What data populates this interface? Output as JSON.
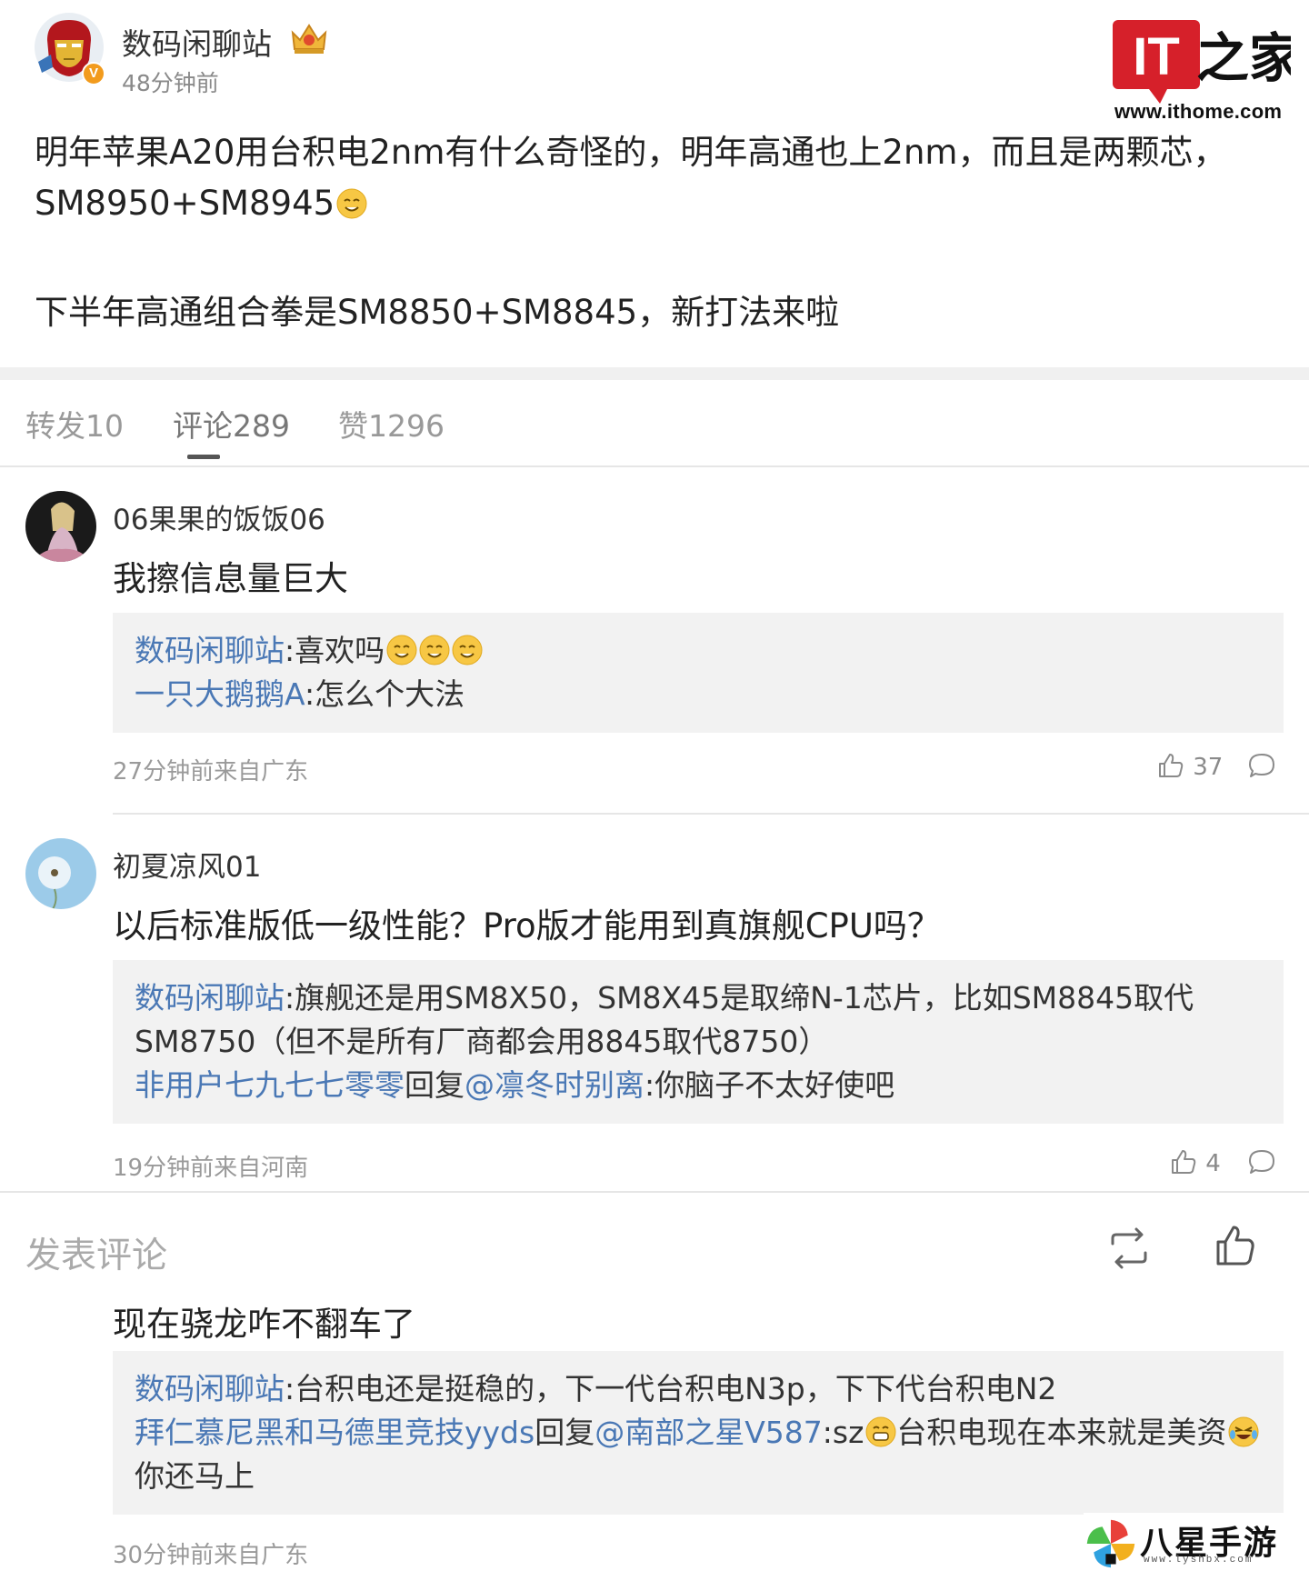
{
  "colors": {
    "link_blue": "#4a78b5",
    "brand_red": "#d6202a",
    "badge_orange": "#f29b1d"
  },
  "post": {
    "author": "数码闲聊站",
    "time": "48分钟前",
    "verified_badge": "V",
    "author_badge_icon": "crown-icon",
    "line1": "明年苹果A20用台积电2nm有什么奇怪的，明年高通也上2nm，而且是两颗芯，",
    "line2": "SM8950+SM8945",
    "line3": "下半年高通组合拳是SM8850+SM8845，新打法来啦"
  },
  "logo": {
    "mark": "IT之家",
    "url": "www.ithome.com"
  },
  "tabs": [
    {
      "label": "转发10"
    },
    {
      "label": "评论289"
    },
    {
      "label": "赞1296"
    }
  ],
  "comments": [
    {
      "user": "06果果的饭饭06",
      "text": "我擦信息量巨大",
      "replies": [
        {
          "name": "数码闲聊站",
          "text": ":喜欢吗"
        },
        {
          "name": "一只大鹅鹅A",
          "text": ":怎么个大法"
        }
      ],
      "meta": "27分钟前来自广东",
      "likes": "37"
    },
    {
      "user": "初夏凉风01",
      "text": "以后标准版低一级性能？Pro版才能用到真旗舰CPU吗？",
      "replies": [
        {
          "name": "数码闲聊站",
          "text": ":旗舰还是用SM8X50，SM8X45是取缔N-1芯片，比如SM8845取代",
          "cont": "SM8750（但不是所有厂商都会用8845取代8750）"
        },
        {
          "name": "非用户七九七七零零",
          "mid": "回复",
          "at": "@凛冬时别离",
          "text": ":你脑子不太好使吧"
        }
      ],
      "meta": "19分钟前来自河南",
      "likes": "4"
    },
    {
      "text": "现在骁龙咋不翻车了",
      "replies": [
        {
          "name": "数码闲聊站",
          "text": ":台积电还是挺稳的，下一代台积电N3p，下下代台积电N2"
        },
        {
          "name": "拜仁慕尼黑和马德里竞技yyds",
          "mid": "回复",
          "at": "@南部之星V587",
          "text": ":sz",
          "text2": "台积电现在本来就是美资",
          "cont": "你还马上"
        }
      ],
      "meta": "30分钟前来自广东"
    }
  ],
  "compose": {
    "placeholder": "发表评论"
  },
  "watermark": {
    "text": "八星手游网",
    "sub": "www.lyshbx.com"
  }
}
